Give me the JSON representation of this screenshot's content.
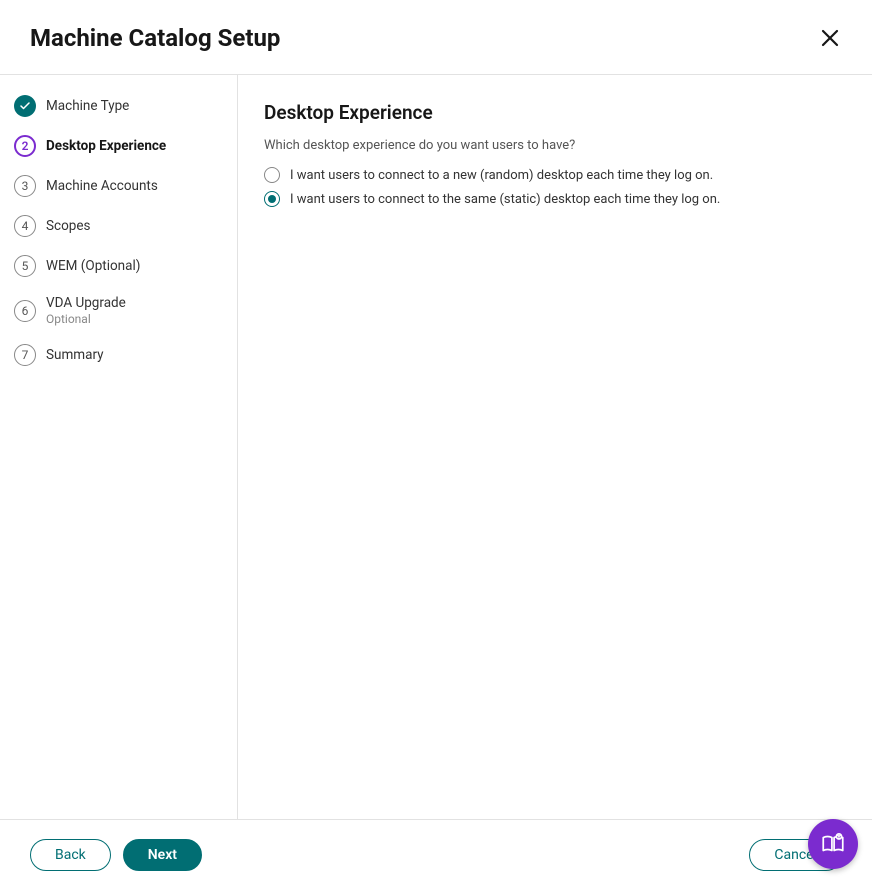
{
  "header": {
    "title": "Machine Catalog Setup"
  },
  "sidebar": {
    "steps": [
      {
        "label": "Machine Type"
      },
      {
        "label": "Desktop Experience",
        "number": "2"
      },
      {
        "label": "Machine Accounts",
        "number": "3"
      },
      {
        "label": "Scopes",
        "number": "4"
      },
      {
        "label": "WEM (Optional)",
        "number": "5"
      },
      {
        "label": "VDA Upgrade",
        "sublabel": "Optional",
        "number": "6"
      },
      {
        "label": "Summary",
        "number": "7"
      }
    ]
  },
  "content": {
    "title": "Desktop Experience",
    "prompt": "Which desktop experience do you want users to have?",
    "options": [
      {
        "label": "I want users to connect to a new (random) desktop each time they log on."
      },
      {
        "label": "I want users to connect to the same (static) desktop each time they log on."
      }
    ]
  },
  "footer": {
    "back": "Back",
    "next": "Next",
    "cancel": "Cancel"
  }
}
